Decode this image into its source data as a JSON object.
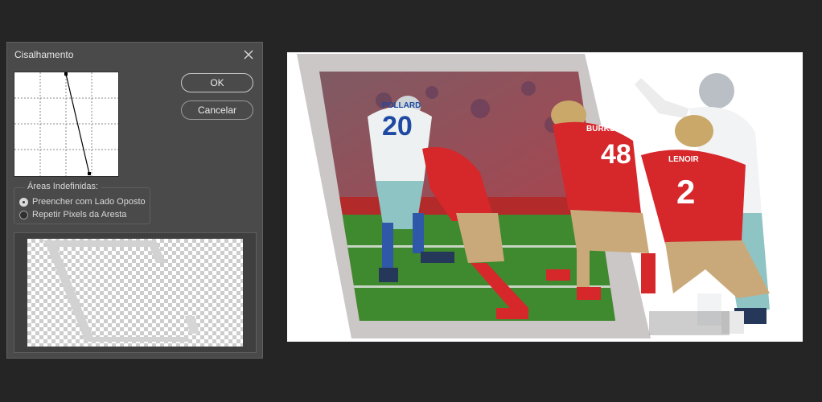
{
  "dialog": {
    "title": "Cisalhamento",
    "ok_label": "OK",
    "cancel_label": "Cancelar",
    "undefined_areas": {
      "legend": "Áreas Indefinidas:",
      "options": [
        {
          "label": "Preencher com Lado Oposto",
          "checked": true
        },
        {
          "label": "Repetir Pixels da Aresta",
          "checked": false
        }
      ]
    }
  },
  "canvas": {
    "players": [
      {
        "number": "20",
        "name": "POLLARD"
      },
      {
        "number": "48",
        "name": "BURKS"
      },
      {
        "number": "2",
        "name": "LENOIR"
      }
    ]
  }
}
